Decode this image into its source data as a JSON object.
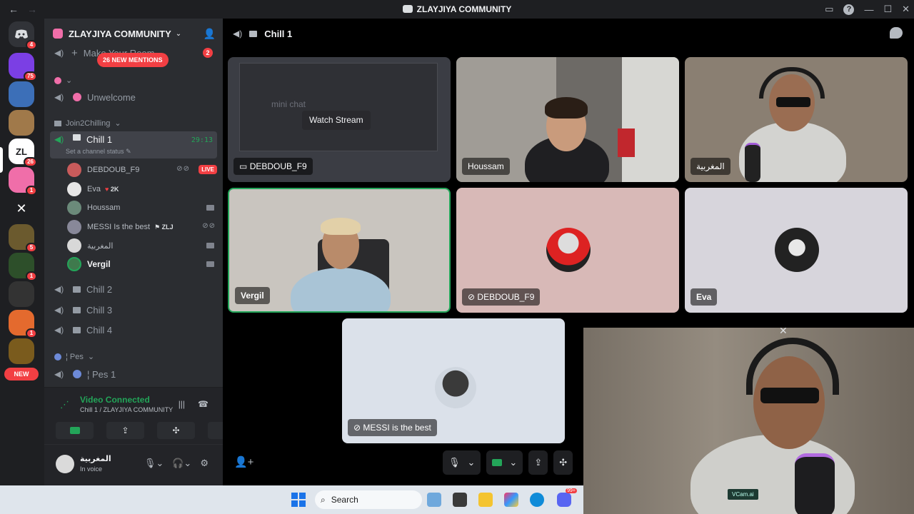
{
  "window": {
    "title": "ZLAYJIYA COMMUNITY",
    "back_icon": "arrow-left-icon",
    "forward_icon": "arrow-right-icon"
  },
  "rail": {
    "new_pill": "NEW",
    "servers": [
      {
        "color": "#5865f2",
        "label": "",
        "badge": "4"
      },
      {
        "color": "#7b3fe4",
        "label": "",
        "badge": "75"
      },
      {
        "color": "#3c6fb8",
        "label": "",
        "badge": ""
      },
      {
        "color": "#a0794a",
        "label": "",
        "badge": ""
      },
      {
        "color": "#ffffff",
        "label": "ZL",
        "badge": "26"
      },
      {
        "color": "#f06ea9",
        "label": "",
        "badge": "1"
      },
      {
        "color": "#1e1f22",
        "label": "",
        "badge": ""
      },
      {
        "color": "#6b5a2e",
        "label": "",
        "badge": "5"
      },
      {
        "color": "#2d4f2a",
        "label": "",
        "badge": "1"
      },
      {
        "color": "#333333",
        "label": "",
        "badge": ""
      },
      {
        "color": "#e46a2e",
        "label": "",
        "badge": "1"
      },
      {
        "color": "#7a5b1d",
        "label": "",
        "badge": ""
      }
    ]
  },
  "sidebar": {
    "server_name": "ZLAYJIYA COMMUNITY",
    "mentions_pill": "26 NEW MENTIONS",
    "top_channel": "Make Your Room",
    "top_badge": "2",
    "unwelcome": "Unwelcome",
    "category_join": "Join2Chilling",
    "active_channel": {
      "name": "Chill 1",
      "timer": "29:13",
      "status": "Set a channel status"
    },
    "members": [
      {
        "name": "DEBDOUB_F9",
        "tag": "",
        "live": "LIVE",
        "avatar": "#c95b5b"
      },
      {
        "name": "Eva",
        "tag": "2K",
        "live": "",
        "avatar": "#e6e6e6"
      },
      {
        "name": "Houssam",
        "tag": "",
        "live": "",
        "avatar": "#6b8a7a"
      },
      {
        "name": "MESSI Is the best",
        "tag": "ZLJ",
        "live": "",
        "avatar": "#889"
      },
      {
        "name": "المغربية",
        "tag": "",
        "live": "",
        "avatar": "#d8d8d8"
      },
      {
        "name": "Vergil",
        "tag": "",
        "live": "",
        "avatar": "#3f7a4d"
      }
    ],
    "channels": [
      "Chill 2",
      "Chill 3",
      "Chill 4"
    ],
    "category_pes": "Pes",
    "pes_channel": "Pes 1"
  },
  "voice_panel": {
    "title": "Video Connected",
    "subtitle": "Chill 1 / ZLAYJIYA COMMUNITY"
  },
  "user_panel": {
    "name": "المغربية",
    "status": "In voice"
  },
  "stage": {
    "channel_name": "Chill 1",
    "watch_stream": "Watch Stream",
    "tiles": {
      "stream": "DEBDOUB_F9",
      "houssam": "Houssam",
      "maghribiya": "المغربية",
      "vergil": "Vergil",
      "debdoub": "DEBDOUB_F9",
      "eva": "Eva",
      "messi": "MESSI is the best"
    },
    "pip_watermark": "VCam.ai",
    "stream_screen_text": "mini chat"
  },
  "taskbar": {
    "search": "Search",
    "discord_badge": "99+"
  },
  "colors": {
    "accent_green": "#23a559",
    "mention_red": "#f23f43",
    "bg_dark": "#1e1f22",
    "sidebar": "#2b2d31",
    "tile_pink": "#d8b9b7",
    "tile_lavender": "#d7d5dc",
    "tile_light": "#dbe1ea"
  }
}
